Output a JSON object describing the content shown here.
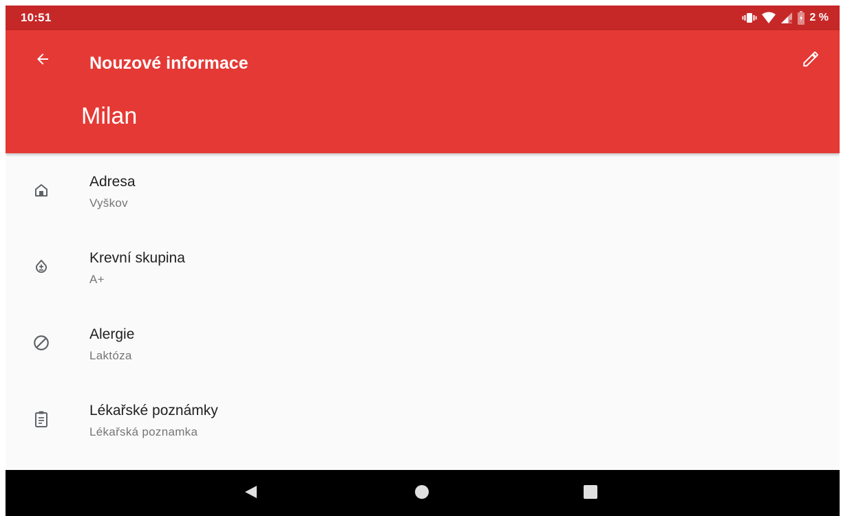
{
  "status_bar": {
    "time": "10:51",
    "battery": "2 %",
    "icons": [
      "vibrate-icon",
      "wifi-icon",
      "signal-icon",
      "battery-icon"
    ]
  },
  "app_bar": {
    "title": "Nouzové informace",
    "user_name": "Milan",
    "back_icon": "arrow-back-icon",
    "edit_icon": "pencil-icon",
    "color": "#e53935",
    "status_color": "#c62828"
  },
  "items": [
    {
      "label": "Adresa",
      "value": "Vyškov",
      "icon": "home-icon"
    },
    {
      "label": "Krevní skupina",
      "value": "A+",
      "icon": "blood-drop-icon"
    },
    {
      "label": "Alergie",
      "value": "Laktóza",
      "icon": "block-icon"
    },
    {
      "label": "Lékařské poznámky",
      "value": "Lékařská poznamka",
      "icon": "clipboard-icon"
    }
  ],
  "nav_bar": {
    "buttons": [
      "back-triangle-icon",
      "home-circle-icon",
      "recents-square-icon"
    ]
  }
}
